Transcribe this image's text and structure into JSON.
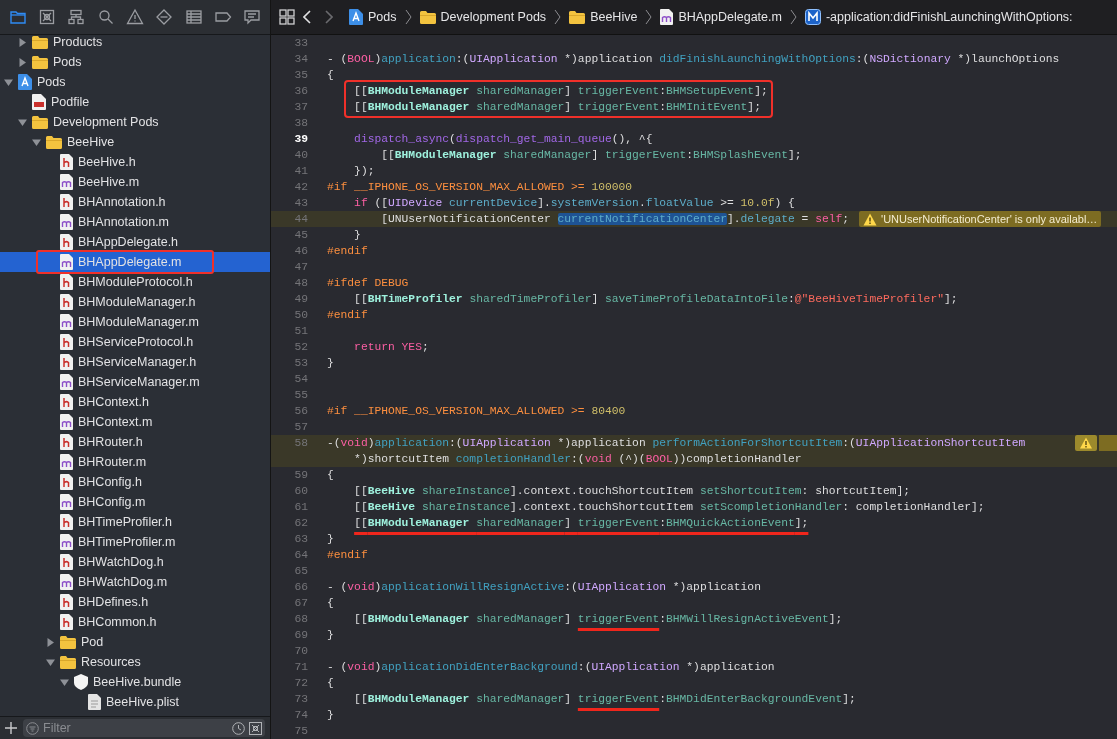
{
  "navigator": {
    "tabs": [
      {
        "selected": true
      },
      {
        "selected": false
      },
      {
        "selected": false
      },
      {
        "selected": false
      },
      {
        "selected": false
      },
      {
        "selected": false
      },
      {
        "selected": false
      },
      {
        "selected": false
      },
      {
        "selected": false
      }
    ],
    "scrolled_items": [
      {
        "label": "Products",
        "kind": "folder",
        "expanded": false,
        "selected": false,
        "annotated": false
      },
      {
        "label": "Pods",
        "kind": "folder",
        "expanded": false,
        "selected": false,
        "annotated": false
      }
    ],
    "tree": [
      {
        "label": "Pods",
        "kind": "project",
        "expanded": true,
        "selected": false,
        "annotated": false,
        "children": [
          {
            "label": "Podfile",
            "kind": "ruby",
            "selected": false,
            "annotated": false
          },
          {
            "label": "Development Pods",
            "kind": "folder",
            "expanded": true,
            "selected": false,
            "annotated": false,
            "children": [
              {
                "label": "BeeHive",
                "kind": "folder",
                "expanded": true,
                "selected": false,
                "annotated": false,
                "children": [
                  {
                    "label": "BeeHive.h",
                    "kind": "header",
                    "selected": false,
                    "annotated": false
                  },
                  {
                    "label": "BeeHive.m",
                    "kind": "source",
                    "selected": false,
                    "annotated": false
                  },
                  {
                    "label": "BHAnnotation.h",
                    "kind": "header",
                    "selected": false,
                    "annotated": false
                  },
                  {
                    "label": "BHAnnotation.m",
                    "kind": "source",
                    "selected": false,
                    "annotated": false
                  },
                  {
                    "label": "BHAppDelegate.h",
                    "kind": "header",
                    "selected": false,
                    "annotated": false
                  },
                  {
                    "label": "BHAppDelegate.m",
                    "kind": "source",
                    "selected": true,
                    "annotated": true
                  },
                  {
                    "label": "BHModuleProtocol.h",
                    "kind": "header",
                    "selected": false,
                    "annotated": false
                  },
                  {
                    "label": "BHModuleManager.h",
                    "kind": "header",
                    "selected": false,
                    "annotated": false
                  },
                  {
                    "label": "BHModuleManager.m",
                    "kind": "source",
                    "selected": false,
                    "annotated": false
                  },
                  {
                    "label": "BHServiceProtocol.h",
                    "kind": "header",
                    "selected": false,
                    "annotated": false
                  },
                  {
                    "label": "BHServiceManager.h",
                    "kind": "header",
                    "selected": false,
                    "annotated": false
                  },
                  {
                    "label": "BHServiceManager.m",
                    "kind": "source",
                    "selected": false,
                    "annotated": false
                  },
                  {
                    "label": "BHContext.h",
                    "kind": "header",
                    "selected": false,
                    "annotated": false
                  },
                  {
                    "label": "BHContext.m",
                    "kind": "source",
                    "selected": false,
                    "annotated": false
                  },
                  {
                    "label": "BHRouter.h",
                    "kind": "header",
                    "selected": false,
                    "annotated": false
                  },
                  {
                    "label": "BHRouter.m",
                    "kind": "source",
                    "selected": false,
                    "annotated": false
                  },
                  {
                    "label": "BHConfig.h",
                    "kind": "header",
                    "selected": false,
                    "annotated": false
                  },
                  {
                    "label": "BHConfig.m",
                    "kind": "source",
                    "selected": false,
                    "annotated": false
                  },
                  {
                    "label": "BHTimeProfiler.h",
                    "kind": "header",
                    "selected": false,
                    "annotated": false
                  },
                  {
                    "label": "BHTimeProfiler.m",
                    "kind": "source",
                    "selected": false,
                    "annotated": false
                  },
                  {
                    "label": "BHWatchDog.h",
                    "kind": "header",
                    "selected": false,
                    "annotated": false
                  },
                  {
                    "label": "BHWatchDog.m",
                    "kind": "source",
                    "selected": false,
                    "annotated": false
                  },
                  {
                    "label": "BHDefines.h",
                    "kind": "header",
                    "selected": false,
                    "annotated": false
                  },
                  {
                    "label": "BHCommon.h",
                    "kind": "header",
                    "selected": false,
                    "annotated": false
                  },
                  {
                    "label": "Pod",
                    "kind": "folder",
                    "expanded": false,
                    "selected": false,
                    "annotated": false
                  },
                  {
                    "label": "Resources",
                    "kind": "folder",
                    "expanded": true,
                    "selected": false,
                    "annotated": false,
                    "children": [
                      {
                        "label": "BeeHive.bundle",
                        "kind": "bundle",
                        "expanded": true,
                        "selected": false,
                        "annotated": false,
                        "children": [
                          {
                            "label": "BeeHive.plist",
                            "kind": "plist",
                            "selected": false,
                            "annotated": false
                          }
                        ]
                      }
                    ]
                  }
                ]
              }
            ]
          }
        ]
      }
    ],
    "filter": {
      "placeholder": "Filter"
    }
  },
  "jump_bar": [
    {
      "label": "Pods",
      "kind": "project"
    },
    {
      "label": "Development Pods",
      "kind": "folder"
    },
    {
      "label": "BeeHive",
      "kind": "folder"
    },
    {
      "label": "BHAppDelegate.m",
      "kind": "source"
    },
    {
      "label": "-application:didFinishLaunchingWithOptions:",
      "kind": "method"
    }
  ],
  "editor": {
    "lines": [
      {
        "num": "33",
        "current": false,
        "warning": false,
        "boxed": false
      },
      {
        "num": "34",
        "current": false,
        "warning": false,
        "boxed": false,
        "tokens": [
          {
            "text": "- (",
            "kind": "plain"
          },
          {
            "text": "BOOL",
            "kind": "keyword"
          },
          {
            "text": ")",
            "kind": "plain"
          },
          {
            "text": "application",
            "kind": "decl"
          },
          {
            "text": ":(",
            "kind": "plain"
          },
          {
            "text": "UIApplication",
            "kind": "type"
          },
          {
            "text": " *)application ",
            "kind": "plain"
          },
          {
            "text": "didFinishLaunchingWithOptions",
            "kind": "decl"
          },
          {
            "text": ":(",
            "kind": "plain"
          },
          {
            "text": "NSDictionary",
            "kind": "type"
          },
          {
            "text": " *)launchOptions",
            "kind": "plain"
          }
        ]
      },
      {
        "num": "35",
        "current": false,
        "warning": false,
        "boxed": false,
        "tokens": [
          {
            "text": "{",
            "kind": "plain"
          }
        ]
      },
      {
        "num": "36",
        "current": false,
        "warning": false,
        "boxed": true,
        "tokens": [
          {
            "text": "    [[",
            "kind": "plain"
          },
          {
            "text": "BHModuleManager ",
            "kind": "class"
          },
          {
            "text": "sharedManager",
            "kind": "method"
          },
          {
            "text": "] ",
            "kind": "plain"
          },
          {
            "text": "triggerEvent",
            "kind": "method"
          },
          {
            "text": ":",
            "kind": "plain"
          },
          {
            "text": "BHMSetupEvent",
            "kind": "method"
          },
          {
            "text": "];",
            "kind": "plain"
          }
        ]
      },
      {
        "num": "37",
        "current": false,
        "warning": false,
        "boxed": true,
        "tokens": [
          {
            "text": "    [[",
            "kind": "plain"
          },
          {
            "text": "BHModuleManager ",
            "kind": "class"
          },
          {
            "text": "sharedManager",
            "kind": "method"
          },
          {
            "text": "] ",
            "kind": "plain"
          },
          {
            "text": "triggerEvent",
            "kind": "method"
          },
          {
            "text": ":",
            "kind": "plain"
          },
          {
            "text": "BHMInitEvent",
            "kind": "method"
          },
          {
            "text": "];",
            "kind": "plain"
          }
        ]
      },
      {
        "num": "38",
        "current": false,
        "warning": false,
        "boxed": false
      },
      {
        "num": "39",
        "current": true,
        "warning": false,
        "boxed": false,
        "tokens": [
          {
            "text": "    dispatch_async",
            "kind": "func"
          },
          {
            "text": "(",
            "kind": "plain"
          },
          {
            "text": "dispatch_get_main_queue",
            "kind": "func"
          },
          {
            "text": "(), ^{",
            "kind": "plain"
          }
        ]
      },
      {
        "num": "40",
        "current": false,
        "warning": false,
        "boxed": false,
        "tokens": [
          {
            "text": "        [[",
            "kind": "plain"
          },
          {
            "text": "BHModuleManager ",
            "kind": "class"
          },
          {
            "text": "sharedManager",
            "kind": "method"
          },
          {
            "text": "] ",
            "kind": "plain"
          },
          {
            "text": "triggerEvent",
            "kind": "method"
          },
          {
            "text": ":",
            "kind": "plain"
          },
          {
            "text": "BHMSplashEvent",
            "kind": "method"
          },
          {
            "text": "];",
            "kind": "plain"
          }
        ]
      },
      {
        "num": "41",
        "current": false,
        "warning": false,
        "boxed": false,
        "tokens": [
          {
            "text": "    });",
            "kind": "plain"
          }
        ]
      },
      {
        "num": "42",
        "current": false,
        "warning": false,
        "boxed": false,
        "tokens": [
          {
            "text": "#if __IPHONE_OS_VERSION_MAX_ALLOWED >= ",
            "kind": "macro"
          },
          {
            "text": "100000",
            "kind": "number"
          }
        ]
      },
      {
        "num": "43",
        "current": false,
        "warning": false,
        "boxed": false,
        "tokens": [
          {
            "text": "    if",
            "kind": "keyword"
          },
          {
            "text": " ([",
            "kind": "plain"
          },
          {
            "text": "UIDevice ",
            "kind": "type"
          },
          {
            "text": "currentDevice",
            "kind": "prop"
          },
          {
            "text": "].",
            "kind": "plain"
          },
          {
            "text": "systemVersion",
            "kind": "prop"
          },
          {
            "text": ".",
            "kind": "plain"
          },
          {
            "text": "floatValue",
            "kind": "prop"
          },
          {
            "text": " >= ",
            "kind": "plain"
          },
          {
            "text": "10.0f",
            "kind": "number"
          },
          {
            "text": ") {",
            "kind": "plain"
          }
        ]
      },
      {
        "num": "44",
        "current": false,
        "warning": true,
        "boxed": false,
        "warning_message": "'UNUserNotificationCenter' is only availabl…",
        "tokens": [
          {
            "text": "        [UNUserNotificationCenter ",
            "kind": "plain"
          },
          {
            "text": "currentNotificationCenter",
            "kind": "prop",
            "selected": true
          },
          {
            "text": "].",
            "kind": "plain"
          },
          {
            "text": "delegate",
            "kind": "prop"
          },
          {
            "text": " = ",
            "kind": "plain"
          },
          {
            "text": "self",
            "kind": "keyword"
          },
          {
            "text": ";",
            "kind": "plain"
          }
        ]
      },
      {
        "num": "45",
        "current": false,
        "warning": false,
        "boxed": false,
        "tokens": [
          {
            "text": "    }",
            "kind": "plain"
          }
        ]
      },
      {
        "num": "46",
        "current": false,
        "warning": false,
        "boxed": false,
        "tokens": [
          {
            "text": "#endif",
            "kind": "macro"
          }
        ]
      },
      {
        "num": "47",
        "current": false,
        "warning": false,
        "boxed": false
      },
      {
        "num": "48",
        "current": false,
        "warning": false,
        "boxed": false,
        "tokens": [
          {
            "text": "#ifdef DEBUG",
            "kind": "macro"
          }
        ]
      },
      {
        "num": "49",
        "current": false,
        "warning": false,
        "boxed": false,
        "tokens": [
          {
            "text": "    [[",
            "kind": "plain"
          },
          {
            "text": "BHTimeProfiler ",
            "kind": "class"
          },
          {
            "text": "sharedTimeProfiler",
            "kind": "method"
          },
          {
            "text": "] ",
            "kind": "plain"
          },
          {
            "text": "saveTimeProfileDataIntoFile",
            "kind": "method"
          },
          {
            "text": ":",
            "kind": "plain"
          },
          {
            "text": "@\"BeeHiveTimeProfiler\"",
            "kind": "string"
          },
          {
            "text": "];",
            "kind": "plain"
          }
        ]
      },
      {
        "num": "50",
        "current": false,
        "warning": false,
        "boxed": false,
        "tokens": [
          {
            "text": "#endif",
            "kind": "macro"
          }
        ]
      },
      {
        "num": "51",
        "current": false,
        "warning": false,
        "boxed": false
      },
      {
        "num": "52",
        "current": false,
        "warning": false,
        "boxed": false,
        "tokens": [
          {
            "text": "    return ",
            "kind": "keyword"
          },
          {
            "text": "YES",
            "kind": "keyword"
          },
          {
            "text": ";",
            "kind": "plain"
          }
        ]
      },
      {
        "num": "53",
        "current": false,
        "warning": false,
        "boxed": false,
        "tokens": [
          {
            "text": "}",
            "kind": "plain"
          }
        ]
      },
      {
        "num": "54",
        "current": false,
        "warning": false,
        "boxed": false
      },
      {
        "num": "55",
        "current": false,
        "warning": false,
        "boxed": false
      },
      {
        "num": "56",
        "current": false,
        "warning": false,
        "boxed": false,
        "tokens": [
          {
            "text": "#if __IPHONE_OS_VERSION_MAX_ALLOWED >= ",
            "kind": "macro"
          },
          {
            "text": "80400",
            "kind": "number"
          }
        ]
      },
      {
        "num": "57",
        "current": false,
        "warning": false,
        "boxed": false
      },
      {
        "num": "58",
        "current": false,
        "warning": true,
        "boxed": false,
        "tokens": [
          {
            "text": "-(",
            "kind": "plain"
          },
          {
            "text": "void",
            "kind": "keyword"
          },
          {
            "text": ")",
            "kind": "plain"
          },
          {
            "text": "application",
            "kind": "decl"
          },
          {
            "text": ":(",
            "kind": "plain"
          },
          {
            "text": "UIApplication",
            "kind": "type"
          },
          {
            "text": " *)application ",
            "kind": "plain"
          },
          {
            "text": "performActionForShortcutItem",
            "kind": "decl"
          },
          {
            "text": ":(",
            "kind": "plain"
          },
          {
            "text": "UIApplicationShortcutItem",
            "kind": "type"
          }
        ],
        "wrapped_tokens": [
          {
            "text": "    *)shortcutItem ",
            "kind": "plain"
          },
          {
            "text": "completionHandler",
            "kind": "decl"
          },
          {
            "text": ":(",
            "kind": "plain"
          },
          {
            "text": "void",
            "kind": "keyword"
          },
          {
            "text": " (^)(",
            "kind": "plain"
          },
          {
            "text": "BOOL",
            "kind": "keyword"
          },
          {
            "text": "))completionHandler",
            "kind": "plain"
          }
        ]
      },
      {
        "num": "59",
        "current": false,
        "warning": false,
        "boxed": false,
        "tokens": [
          {
            "text": "{",
            "kind": "plain"
          }
        ]
      },
      {
        "num": "60",
        "current": false,
        "warning": false,
        "boxed": false,
        "tokens": [
          {
            "text": "    [[",
            "kind": "plain"
          },
          {
            "text": "BeeHive ",
            "kind": "class"
          },
          {
            "text": "shareInstance",
            "kind": "method"
          },
          {
            "text": "].context.touchShortcutItem ",
            "kind": "plain"
          },
          {
            "text": "setShortcutItem",
            "kind": "method"
          },
          {
            "text": ": shortcutItem];",
            "kind": "plain"
          }
        ]
      },
      {
        "num": "61",
        "current": false,
        "warning": false,
        "boxed": false,
        "tokens": [
          {
            "text": "    [[",
            "kind": "plain"
          },
          {
            "text": "BeeHive ",
            "kind": "class"
          },
          {
            "text": "shareInstance",
            "kind": "method"
          },
          {
            "text": "].context.touchShortcutItem ",
            "kind": "plain"
          },
          {
            "text": "setScompletionHandler",
            "kind": "method"
          },
          {
            "text": ": completionHandler];",
            "kind": "plain"
          }
        ]
      },
      {
        "num": "62",
        "current": false,
        "warning": false,
        "boxed": false,
        "tokens": [
          {
            "text": "    [[",
            "kind": "plain",
            "underlined": true
          },
          {
            "text": "BHModuleManager ",
            "kind": "class",
            "underlined": true
          },
          {
            "text": "sharedManager",
            "kind": "method",
            "underlined": true
          },
          {
            "text": "] ",
            "kind": "plain",
            "underlined": true
          },
          {
            "text": "triggerEvent",
            "kind": "method",
            "underlined": true
          },
          {
            "text": ":",
            "kind": "plain",
            "underlined": true
          },
          {
            "text": "BHMQuickActionEvent",
            "kind": "method",
            "underlined": true
          },
          {
            "text": "];",
            "kind": "plain",
            "underlined": true
          }
        ]
      },
      {
        "num": "63",
        "current": false,
        "warning": false,
        "boxed": false,
        "tokens": [
          {
            "text": "}",
            "kind": "plain"
          }
        ]
      },
      {
        "num": "64",
        "current": false,
        "warning": false,
        "boxed": false,
        "tokens": [
          {
            "text": "#endif",
            "kind": "macro"
          }
        ]
      },
      {
        "num": "65",
        "current": false,
        "warning": false,
        "boxed": false
      },
      {
        "num": "66",
        "current": false,
        "warning": false,
        "boxed": false,
        "tokens": [
          {
            "text": "- (",
            "kind": "plain"
          },
          {
            "text": "void",
            "kind": "keyword"
          },
          {
            "text": ")",
            "kind": "plain"
          },
          {
            "text": "applicationWillResignActive",
            "kind": "decl"
          },
          {
            "text": ":(",
            "kind": "plain"
          },
          {
            "text": "UIApplication",
            "kind": "type"
          },
          {
            "text": " *)application",
            "kind": "plain"
          }
        ]
      },
      {
        "num": "67",
        "current": false,
        "warning": false,
        "boxed": false,
        "tokens": [
          {
            "text": "{",
            "kind": "plain"
          }
        ]
      },
      {
        "num": "68",
        "current": false,
        "warning": false,
        "boxed": false,
        "tokens": [
          {
            "text": "    [[",
            "kind": "plain"
          },
          {
            "text": "BHModuleManager ",
            "kind": "class"
          },
          {
            "text": "sharedManager",
            "kind": "method"
          },
          {
            "text": "] ",
            "kind": "plain"
          },
          {
            "text": "triggerEvent",
            "kind": "method",
            "underlined": true
          },
          {
            "text": ":",
            "kind": "plain"
          },
          {
            "text": "BHMWillResignActiveEvent",
            "kind": "method"
          },
          {
            "text": "];",
            "kind": "plain"
          }
        ]
      },
      {
        "num": "69",
        "current": false,
        "warning": false,
        "boxed": false,
        "tokens": [
          {
            "text": "}",
            "kind": "plain"
          }
        ]
      },
      {
        "num": "70",
        "current": false,
        "warning": false,
        "boxed": false
      },
      {
        "num": "71",
        "current": false,
        "warning": false,
        "boxed": false,
        "tokens": [
          {
            "text": "- (",
            "kind": "plain"
          },
          {
            "text": "void",
            "kind": "keyword"
          },
          {
            "text": ")",
            "kind": "plain"
          },
          {
            "text": "applicationDidEnterBackground",
            "kind": "decl"
          },
          {
            "text": ":(",
            "kind": "plain"
          },
          {
            "text": "UIApplication",
            "kind": "type"
          },
          {
            "text": " *)application",
            "kind": "plain"
          }
        ]
      },
      {
        "num": "72",
        "current": false,
        "warning": false,
        "boxed": false,
        "tokens": [
          {
            "text": "{",
            "kind": "plain"
          }
        ]
      },
      {
        "num": "73",
        "current": false,
        "warning": false,
        "boxed": false,
        "tokens": [
          {
            "text": "    [[",
            "kind": "plain"
          },
          {
            "text": "BHModuleManager ",
            "kind": "class"
          },
          {
            "text": "sharedManager",
            "kind": "method"
          },
          {
            "text": "] ",
            "kind": "plain"
          },
          {
            "text": "triggerEvent",
            "kind": "method",
            "underlined": true
          },
          {
            "text": ":",
            "kind": "plain"
          },
          {
            "text": "BHMDidEnterBackgroundEvent",
            "kind": "method"
          },
          {
            "text": "];",
            "kind": "plain"
          }
        ]
      },
      {
        "num": "74",
        "current": false,
        "warning": false,
        "boxed": false,
        "tokens": [
          {
            "text": "}",
            "kind": "plain"
          }
        ]
      },
      {
        "num": "75",
        "current": false,
        "warning": false,
        "boxed": false
      }
    ]
  }
}
